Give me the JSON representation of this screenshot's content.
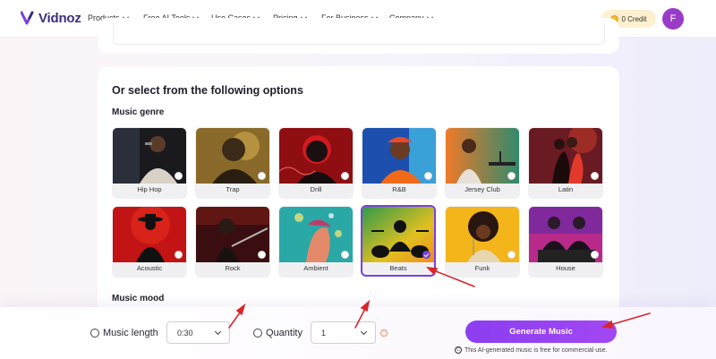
{
  "nav": {
    "logo": "Vidnoz",
    "items": [
      {
        "label": "Products"
      },
      {
        "label": "Free AI Tools"
      },
      {
        "label": "Use Cases"
      },
      {
        "label": "Pricing"
      },
      {
        "label": "For Business"
      },
      {
        "label": "Company"
      }
    ],
    "credit": "0 Credit",
    "avatar": "F"
  },
  "options": {
    "title": "Or select from the following options",
    "genre_label": "Music genre",
    "mood_label": "Music mood",
    "genres": [
      {
        "label": "Hip Hop",
        "selected": false
      },
      {
        "label": "Trap",
        "selected": false
      },
      {
        "label": "Drill",
        "selected": false
      },
      {
        "label": "R&B",
        "selected": false
      },
      {
        "label": "Jersey Club",
        "selected": false
      },
      {
        "label": "Latin",
        "selected": false
      },
      {
        "label": "Acoustic",
        "selected": false
      },
      {
        "label": "Rock",
        "selected": false
      },
      {
        "label": "Ambient",
        "selected": false
      },
      {
        "label": "Beats",
        "selected": true
      },
      {
        "label": "Funk",
        "selected": false
      },
      {
        "label": "House",
        "selected": false
      }
    ]
  },
  "bottom": {
    "length_label": "Music length",
    "length_value": "0:30",
    "quantity_label": "Quantity",
    "quantity_value": "1",
    "generate_label": "Generate Music",
    "note": "This AI-generated music is free for commercial use.",
    "accent_color": "#8b3ef0",
    "annotation_color": "#d9262b"
  }
}
